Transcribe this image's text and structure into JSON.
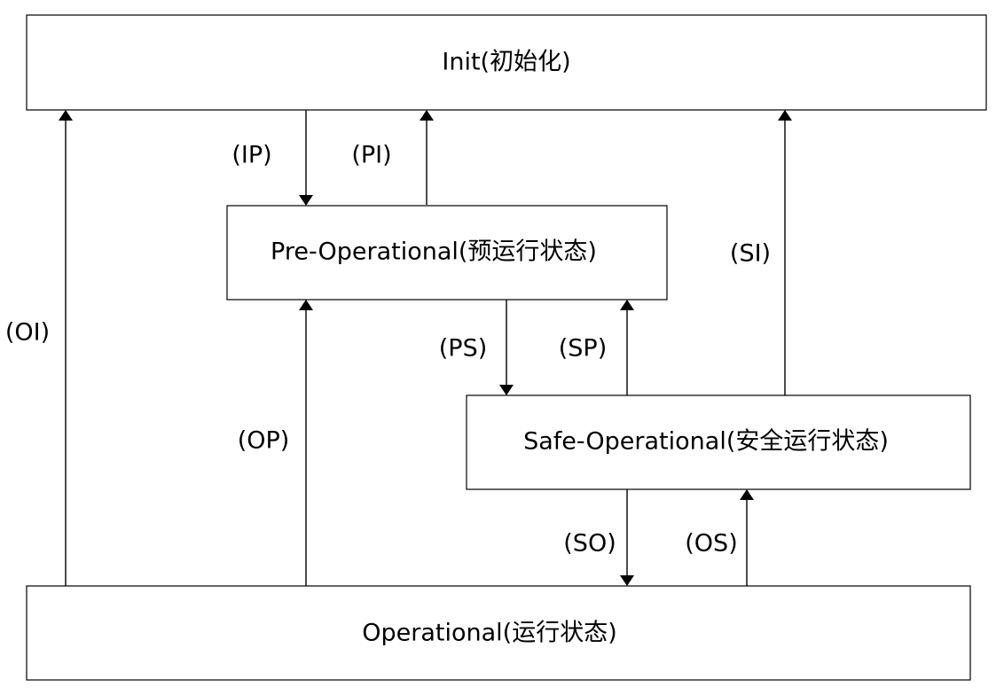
{
  "states": {
    "init": "Init(初始化)",
    "pre_op": "Pre-Operational(预运行状态)",
    "safe_op": "Safe-Operational(安全运行状态)",
    "op": "Operational(运行状态)"
  },
  "transitions": {
    "ip": "(IP)",
    "pi": "(PI)",
    "si": "(SI)",
    "ps": "(PS)",
    "sp": "(SP)",
    "oi": "(OI)",
    "op": "(OP)",
    "so": "(SO)",
    "os": "(OS)"
  }
}
